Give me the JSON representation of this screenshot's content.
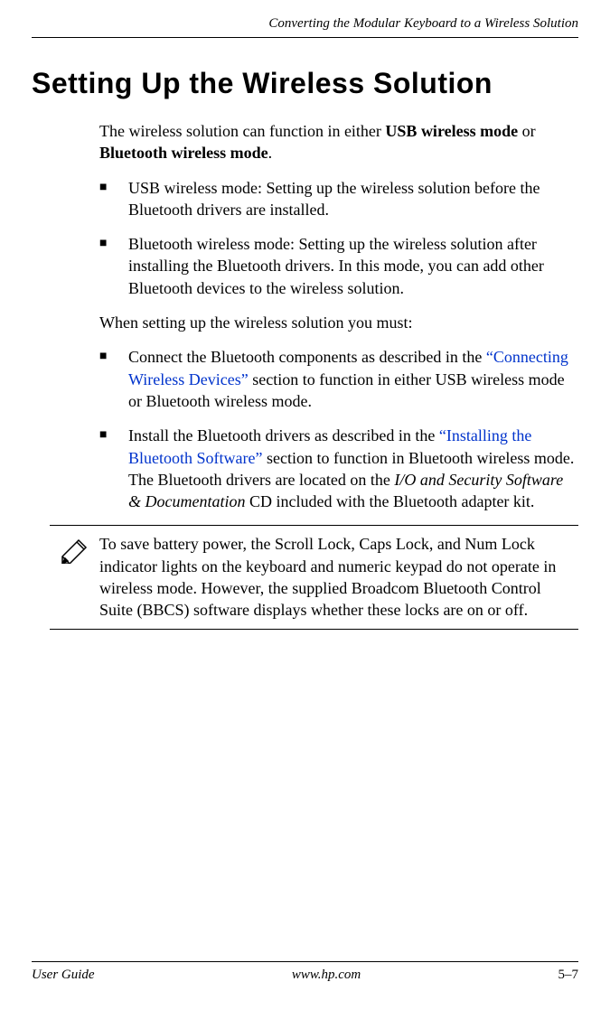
{
  "header": {
    "title": "Converting the Modular Keyboard to a Wireless Solution"
  },
  "main": {
    "title": "Setting Up the Wireless Solution",
    "intro_prefix": "The wireless solution can function in either ",
    "intro_bold1": "USB wireless mode",
    "intro_mid": " or ",
    "intro_bold2": "Bluetooth wireless mode",
    "intro_suffix": ".",
    "bullets1": [
      "USB wireless mode: Setting up the wireless solution before the Bluetooth drivers are installed.",
      "Bluetooth wireless mode: Setting up the wireless solution after installing the Bluetooth drivers. In this mode, you can add other Bluetooth devices to the wireless solution."
    ],
    "para2": "When setting up the wireless solution you must:",
    "bullet3_prefix": "Connect the Bluetooth components as described in the ",
    "bullet3_link": "“Connecting Wireless Devices”",
    "bullet3_suffix": " section to function in either USB wireless mode or Bluetooth wireless mode.",
    "bullet4_prefix": "Install the Bluetooth drivers as described in the ",
    "bullet4_link": "“Installing the Bluetooth Software”",
    "bullet4_mid": " section to function in Bluetooth wireless mode. The Bluetooth drivers are located on the ",
    "bullet4_italic": "I/O and Security Software & Documentation",
    "bullet4_suffix": " CD included with the Bluetooth adapter kit.",
    "note": "To save battery power, the Scroll Lock, Caps Lock, and Num Lock indicator lights on the keyboard and numeric keypad do not operate in wireless mode. However, the supplied Broadcom Bluetooth Control Suite (BBCS) software displays whether these locks are on or off."
  },
  "footer": {
    "left": "User Guide",
    "center": "www.hp.com",
    "right": "5–7"
  }
}
